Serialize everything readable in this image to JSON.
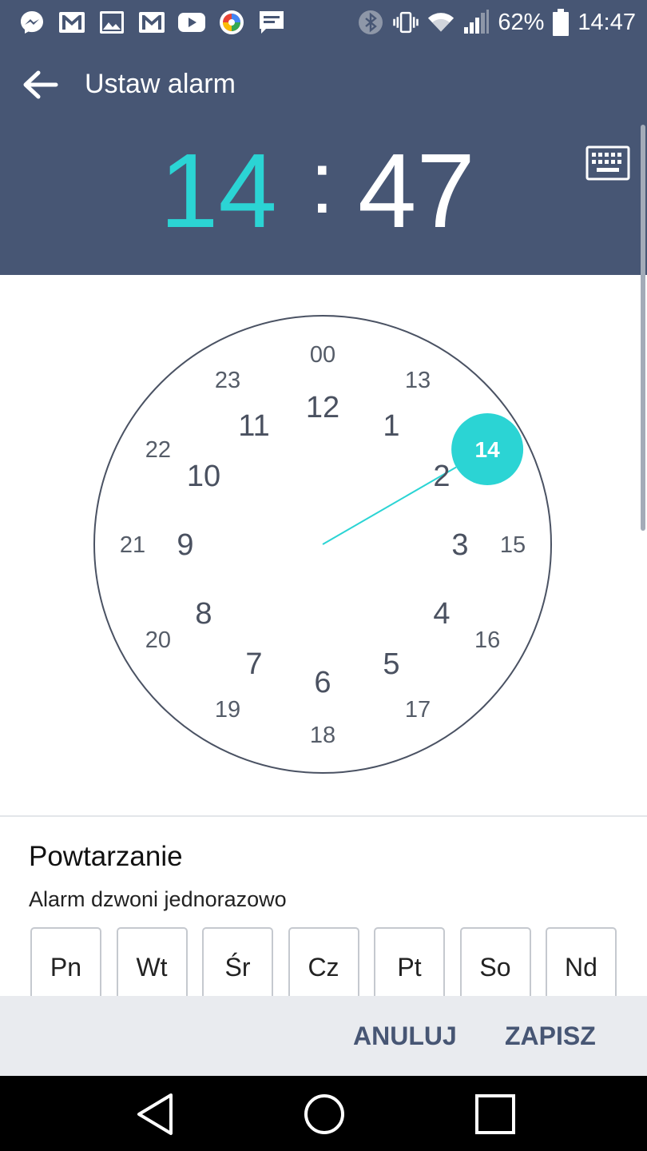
{
  "status_bar": {
    "battery": "62%",
    "time": "14:47",
    "left_icons": [
      "messenger-icon",
      "gmail-icon",
      "gallery-icon",
      "gmail-icon",
      "youtube-icon",
      "photos-icon",
      "message-icon"
    ],
    "right_icons": [
      "bluetooth-icon",
      "vibrate-icon",
      "wifi-icon",
      "signal-icon",
      "battery-icon"
    ]
  },
  "header": {
    "title": "Ustaw alarm",
    "hour": "14",
    "separator": ":",
    "minute": "47"
  },
  "clock": {
    "outer_numbers": [
      "00",
      "13",
      "14",
      "15",
      "16",
      "17",
      "18",
      "19",
      "20",
      "21",
      "22",
      "23"
    ],
    "inner_numbers": [
      "12",
      "1",
      "2",
      "3",
      "4",
      "5",
      "6",
      "7",
      "8",
      "9",
      "10",
      "11"
    ],
    "selected_hour": "14",
    "selected_index": 2,
    "accent": "#2bd4d4"
  },
  "repeat": {
    "title": "Powtarzanie",
    "subtitle": "Alarm dzwoni jednorazowo",
    "days": [
      "Pn",
      "Wt",
      "Śr",
      "Cz",
      "Pt",
      "So",
      "Nd"
    ]
  },
  "actions": {
    "cancel": "ANULUJ",
    "save": "ZAPISZ"
  },
  "colors": {
    "header_bg": "#475674",
    "accent": "#2bd4d4",
    "action_bar_bg": "#e9ebef"
  }
}
